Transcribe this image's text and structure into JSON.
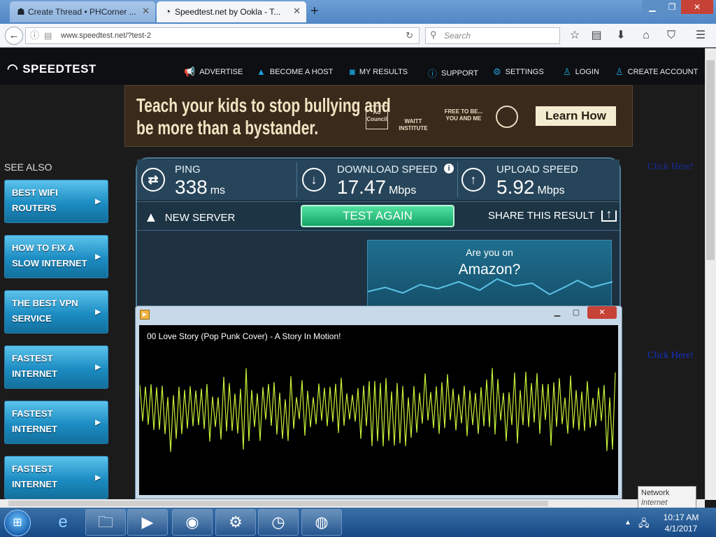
{
  "browser": {
    "tabs": [
      {
        "label": "Create Thread • PHCorner ...",
        "icon": "phcorner-icon"
      },
      {
        "label": "Speedtest.net by Ookla - T...",
        "icon": "speedtest-icon"
      }
    ],
    "new_tab": "+",
    "url": "www.speedtest.net/?test-2",
    "search_placeholder": "Search"
  },
  "speedtest": {
    "logo": "SPEEDTEST",
    "menu": [
      "ADVERTISE",
      "BECOME A HOST",
      "MY RESULTS",
      "SUPPORT",
      "SETTINGS",
      "LOGIN",
      "CREATE ACCOUNT"
    ],
    "ad": {
      "line1": "Teach your kids to stop bullying and",
      "line2": "be more than a bystander.",
      "logo1": "Ad Council",
      "logo2": "WAITT INSTITUTE",
      "logo3": "FREE TO BE... YOU AND ME",
      "cta": "Learn How"
    },
    "see_also": "SEE ALSO",
    "sidebar_items": [
      {
        "line1": "BEST WIFI",
        "line2": "ROUTERS"
      },
      {
        "line1": "HOW TO FIX A",
        "line2": "SLOW INTERNET"
      },
      {
        "line1": "THE BEST VPN",
        "line2": "SERVICE"
      },
      {
        "line1": "FASTEST",
        "line2": "INTERNET"
      },
      {
        "line1": "FASTEST",
        "line2": "INTERNET"
      },
      {
        "line1": "FASTEST",
        "line2": "INTERNET"
      }
    ],
    "results": {
      "ping": {
        "label": "PING",
        "value": "338",
        "unit": "ms"
      },
      "download": {
        "label": "DOWNLOAD SPEED",
        "value": "17.47",
        "unit": "Mbps"
      },
      "upload": {
        "label": "UPLOAD SPEED",
        "value": "5.92",
        "unit": "Mbps"
      }
    },
    "new_server": "NEW SERVER",
    "test_again": "TEST AGAIN",
    "share": "SHARE THIS RESULT",
    "promo": {
      "line1": "Are you on",
      "line2": "Amazon?"
    },
    "click_here": "Click Here!"
  },
  "media": {
    "title": "00 Love Story (Pop Punk Cover) - A Story In Motion!",
    "wave_color": "#c6f03a"
  },
  "tooltip": {
    "title": "Network",
    "sub": "Internet access"
  },
  "clock": {
    "time": "10:17 AM",
    "date": "4/1/2017"
  }
}
